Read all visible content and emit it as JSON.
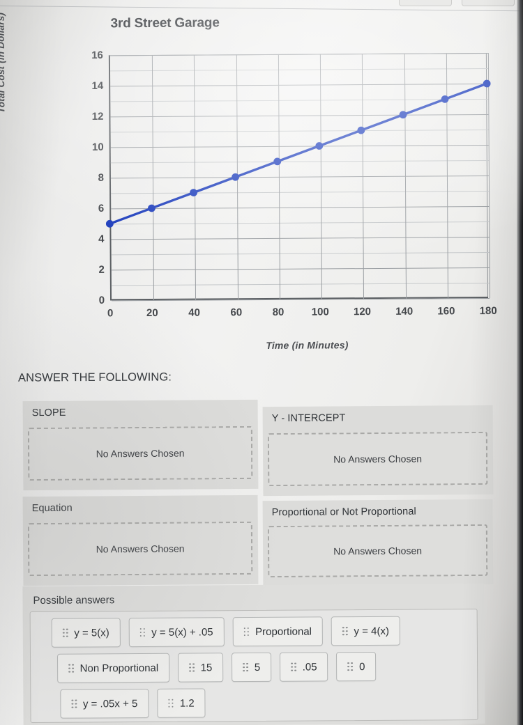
{
  "top_chrome": {
    "pill_count": 2
  },
  "chart_data": {
    "type": "line",
    "title": "3rd Street Garage",
    "xlabel": "Time (in Minutes)",
    "ylabel": "Total Cost (in Dollars)",
    "x": [
      0,
      20,
      40,
      60,
      80,
      100,
      120,
      140,
      160,
      180
    ],
    "values": [
      5,
      6,
      7,
      8,
      9,
      10,
      11,
      12,
      13,
      14
    ],
    "series": [
      {
        "name": "Total Cost",
        "values": [
          5,
          6,
          7,
          8,
          9,
          10,
          11,
          12,
          13,
          14
        ],
        "color": "#1f3fbd"
      }
    ],
    "xlim": [
      0,
      180
    ],
    "ylim": [
      0,
      16
    ],
    "x_ticks": [
      0,
      20,
      40,
      60,
      80,
      100,
      120,
      140,
      160,
      180
    ],
    "y_ticks": [
      0,
      2,
      4,
      6,
      8,
      10,
      12,
      14,
      16
    ],
    "y_minor_step": 1,
    "grid": true,
    "legend": false,
    "marker": "circle",
    "slope": 0.05,
    "y_intercept": 5,
    "equation": "y = .05x + 5"
  },
  "answer_section": {
    "heading": "ANSWER THE FOLLOWING:",
    "empty_text": "No Answers Chosen",
    "slots": [
      {
        "label": "SLOPE",
        "value": "No Answers Chosen"
      },
      {
        "label": "Y - INTERCEPT",
        "value": "No Answers Chosen"
      },
      {
        "label": "Equation",
        "value": "No Answers Chosen"
      },
      {
        "label": "Proportional or Not Proportional",
        "value": "No Answers Chosen"
      }
    ]
  },
  "possible_answers": {
    "label": "Possible answers",
    "handle_icon": "drag-handle-icon",
    "rows": [
      [
        {
          "text": "y = 5(x)"
        },
        {
          "text": "y = 5(x) + .05"
        },
        {
          "text": "Proportional"
        },
        {
          "text": "y = 4(x)"
        }
      ],
      [
        {
          "text": "Non Proportional"
        },
        {
          "text": "15"
        },
        {
          "text": "5"
        },
        {
          "text": ".05"
        },
        {
          "text": "0"
        }
      ],
      [
        {
          "text": "y = .05x + 5"
        },
        {
          "text": "1.2"
        }
      ]
    ]
  },
  "colors": {
    "series_blue": "#1f3fbd",
    "panel_gray": "#dcdcda",
    "text_dark": "#2f3337"
  }
}
